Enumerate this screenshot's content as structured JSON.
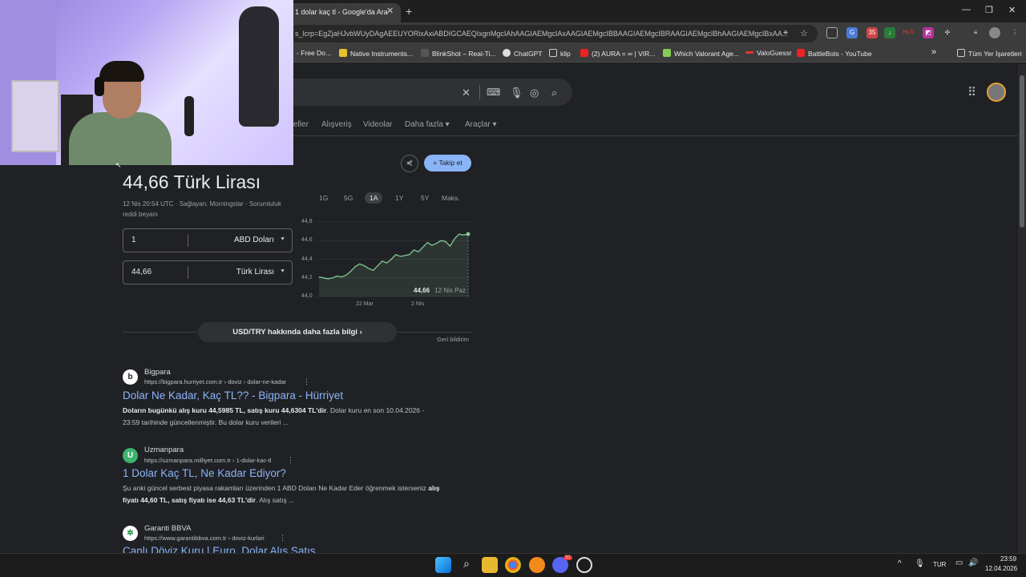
{
  "browser": {
    "tab_title": "1 dolar kaç tl - Google'da Ara",
    "tab_close": "✕",
    "new_tab": "+",
    "url": "s_lcrp=EgZjaHJvbWUyDAgAEEUYORixAxiABDIGCAEQIxgnMgcIAhAAGIAEMgcIAxAAGIAEMgcIBBAAGIAEMgcIBRAAGIAEMgcIBhAAGIAEMgcIBxAA...",
    "window_controls": [
      "—",
      "❐",
      "✕"
    ],
    "extensions": [
      "35",
      "HLS"
    ]
  },
  "bookmarks": [
    {
      "label": "- Free Do...",
      "color": "#c33"
    },
    {
      "label": "Native Instruments...",
      "color": "#e6c229"
    },
    {
      "label": "BlinkShot – Real-Ti...",
      "color": "#555"
    },
    {
      "label": "ChatGPT",
      "color": "#ddd"
    },
    {
      "label": "klip",
      "color": "#888"
    },
    {
      "label": "(2) AURA = ∞ | VIR...",
      "color": "#e22"
    },
    {
      "label": "Which Valorant Age...",
      "color": "#8c5"
    },
    {
      "label": "ValoGuessr",
      "color": "#e33"
    },
    {
      "label": "BattleBots - YouTube",
      "color": "#e22"
    }
  ],
  "bookmarks_more": "»",
  "bookmarks_all": "Tüm Yer İşaretleri",
  "search": {
    "clear": "✕",
    "nav_tabs": [
      "eller",
      "Alışveriş",
      "Videolar",
      "Daha fazla ▾",
      "Araçlar ▾"
    ]
  },
  "currency": {
    "result": "44,66 Türk Lirası",
    "meta_line1": "12 Nis 20:54 UTC · Sağlayan: Morningstar · Sorumluluk",
    "meta_line2": "reddi beyanı",
    "from_value": "1",
    "from_currency": "ABD Doları",
    "to_value": "44,66",
    "to_currency": "Türk Lirası",
    "follow": "+ Takip et",
    "ranges": [
      "1G",
      "5G",
      "1A",
      "1Y",
      "5Y",
      "Maks."
    ],
    "active_range": "1A",
    "tooltip_value": "44,66",
    "tooltip_date": "12 Nis Paz",
    "more_info": "USD/TRY hakkında daha fazla bilgi  ›",
    "feedback": "Geri bildirim"
  },
  "chart_data": {
    "type": "area",
    "y_ticks": [
      "44,8",
      "44,6",
      "44,4",
      "44,2",
      "44,0"
    ],
    "x_ticks": [
      "22 Mar",
      "2 Nis"
    ],
    "ylim": [
      44.0,
      44.8
    ],
    "values": [
      44.21,
      44.2,
      44.19,
      44.2,
      44.22,
      44.21,
      44.23,
      44.27,
      44.32,
      44.35,
      44.33,
      44.3,
      44.28,
      44.33,
      44.38,
      44.36,
      44.4,
      44.45,
      44.43,
      44.44,
      44.45,
      44.5,
      44.48,
      44.53,
      44.58,
      44.55,
      44.57,
      44.6,
      44.59,
      44.54,
      44.62,
      44.67,
      44.66,
      44.67
    ],
    "color": "#81c995"
  },
  "results": [
    {
      "site": "Bigpara",
      "url": "https://bigpara.hurriyet.com.tr › doviz › dolar-ne-kadar",
      "title": "Dolar Ne Kadar, Kaç TL?? - Bigpara - Hürriyet",
      "snippet1_bold": "Doların bugünkü alış kuru 44,5985 TL, satış kuru 44,6304 TL'dir",
      "snippet1_rest": ". Dolar kuru en son 10.04.2026 -",
      "snippet2": "23:59 tarihinde güncellenmiştir. Bu dolar kuru verileri ...",
      "favicon": "b"
    },
    {
      "site": "Uzmanpara",
      "url": "https://uzmanpara.milliyet.com.tr › 1-dolar-kac-tl",
      "title": "1 Dolar Kaç TL, Ne Kadar Ediyor?",
      "snippet1_rest": "Şu anki güncel serbest piyasa rakamları üzerinden 1 ABD Doları Ne Kadar Eder öğrenmek isterseniz ",
      "snippet1_bold": "alış",
      "snippet2_bold": "fiyatı 44,60 TL, satış fiyatı ise 44,63 TL'dir",
      "snippet2": ". Alış satış ...",
      "favicon": "U"
    },
    {
      "site": "Garanti BBVA",
      "url": "https://www.garantibbva.com.tr › doviz-kurlari",
      "title": "Canlı Döviz Kuru | Euro, Dolar Alış Satış",
      "favicon": "✲"
    }
  ],
  "tray": {
    "lang": "TUR",
    "time": "23:59",
    "date": "12.04.2026",
    "discord_badge": "31"
  }
}
